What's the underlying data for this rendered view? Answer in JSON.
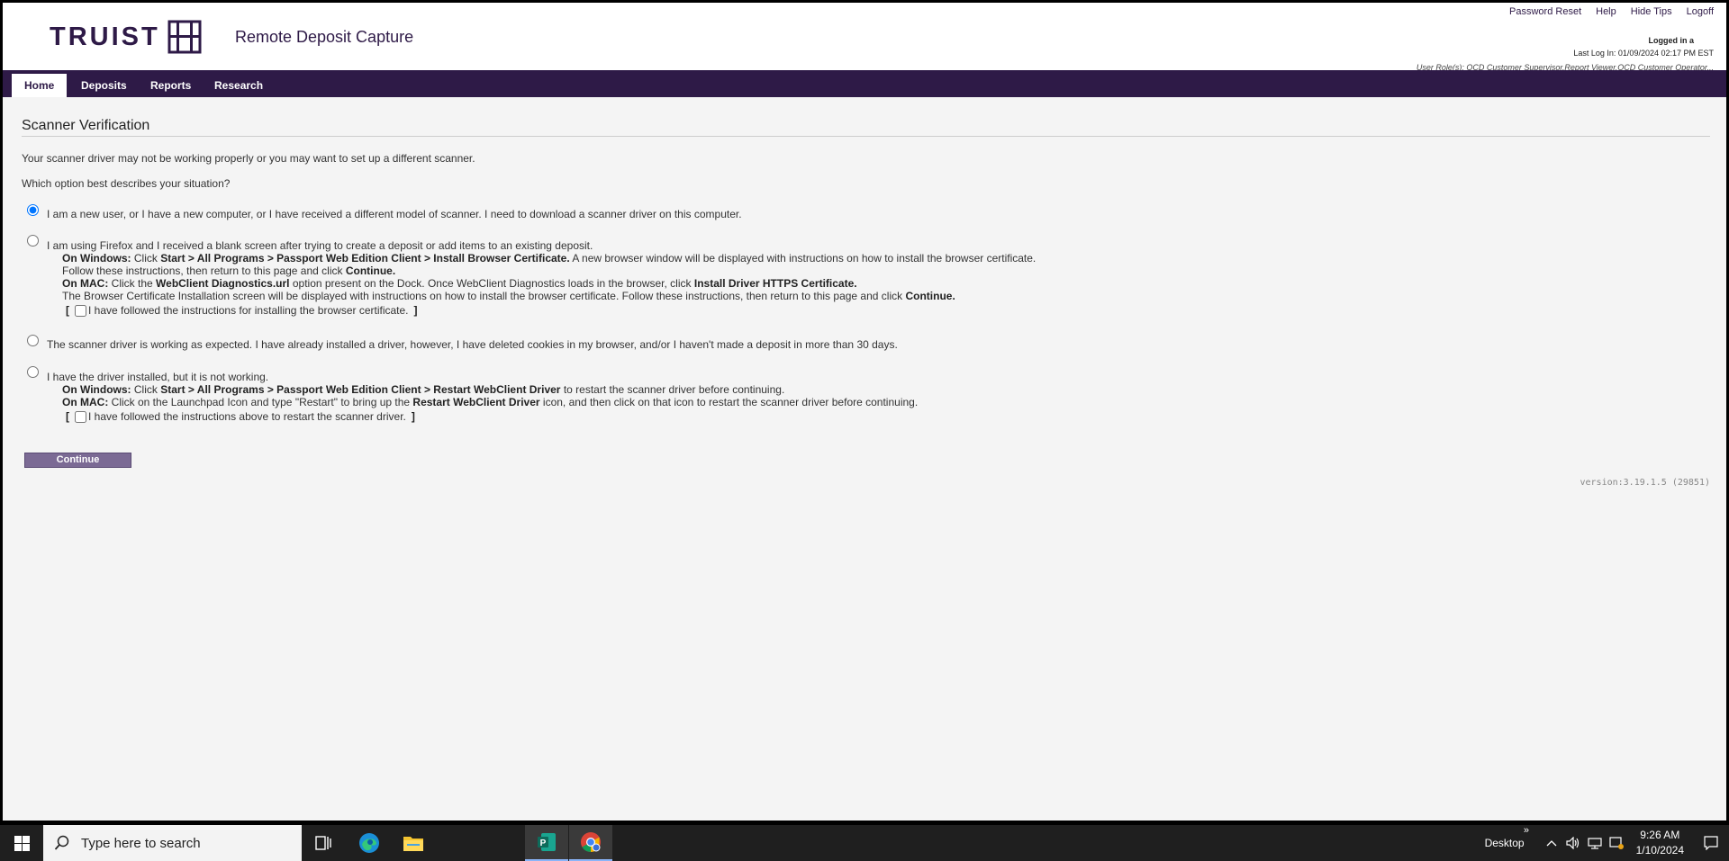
{
  "header": {
    "logo_text": "TRUIST",
    "app_title": "Remote Deposit Capture",
    "links": [
      "Password Reset",
      "Help",
      "Hide Tips",
      "Logoff"
    ],
    "logged_in": "Logged in a",
    "last_login": "Last Log In: 01/09/2024 02:17 PM EST",
    "roles": "User Role(s): OCD Customer Supervisor,Report Viewer,OCD Customer Operator..."
  },
  "nav": {
    "tabs": [
      "Home",
      "Deposits",
      "Reports",
      "Research"
    ],
    "active": "Home"
  },
  "page": {
    "title": "Scanner Verification",
    "intro": "Your scanner driver may not be working properly or you may want to set up a different scanner.",
    "question": "Which option best describes your situation?",
    "option1": "I am a new user, or I have a new computer, or I have received a different model of scanner. I need to download a scanner driver on this computer.",
    "option2": {
      "main": "I am using Firefox and I received a blank screen after trying to create a deposit or add items to an existing deposit.",
      "win_label": "On Windows:",
      "win_t1": "Click",
      "win_b1": "Start > All Programs > Passport Web Edition Client > Install Browser Certificate.",
      "win_t2": "A new browser window will be displayed with instructions on how to install the browser certificate.",
      "win_l2a": "Follow these instructions, then return to this page and click",
      "win_l2b": "Continue.",
      "mac_label": "On MAC:",
      "mac_t1": "Click the",
      "mac_b1": "WebClient Diagnostics.url",
      "mac_t2": "option present on the Dock. Once WebClient Diagnostics loads in the browser, click",
      "mac_b2": "Install Driver HTTPS Certificate.",
      "mac_l2a": "The Browser Certificate Installation screen will be displayed with instructions on how to install the browser certificate. Follow these instructions, then return to this page and click",
      "mac_l2b": "Continue.",
      "checkbox": "I have followed the instructions for installing the browser certificate."
    },
    "option3": "The scanner driver is working as expected. I have already installed a driver, however, I have deleted cookies in my browser, and/or I haven't made a deposit in more than 30 days.",
    "option4": {
      "main": "I have the driver installed, but it is not working.",
      "win_label": "On Windows:",
      "win_t1": "Click",
      "win_b1": "Start > All Programs > Passport Web Edition Client > Restart WebClient Driver",
      "win_t2": "to restart the scanner driver before continuing.",
      "mac_label": "On MAC:",
      "mac_t1": "Click on the Launchpad Icon and type \"Restart\" to bring up the",
      "mac_b1": "Restart WebClient Driver",
      "mac_t2": "icon, and then click on that icon to restart the scanner driver before continuing.",
      "checkbox": "I have followed the instructions above to restart the scanner driver."
    },
    "bracket_open": "[",
    "bracket_close": "]",
    "continue_label": "Continue",
    "version": "version:3.19.1.5 (29851)"
  },
  "taskbar": {
    "search_placeholder": "Type here to search",
    "desktop_label": "Desktop",
    "chevron": "»",
    "time": "9:26 AM",
    "date": "1/10/2024"
  }
}
